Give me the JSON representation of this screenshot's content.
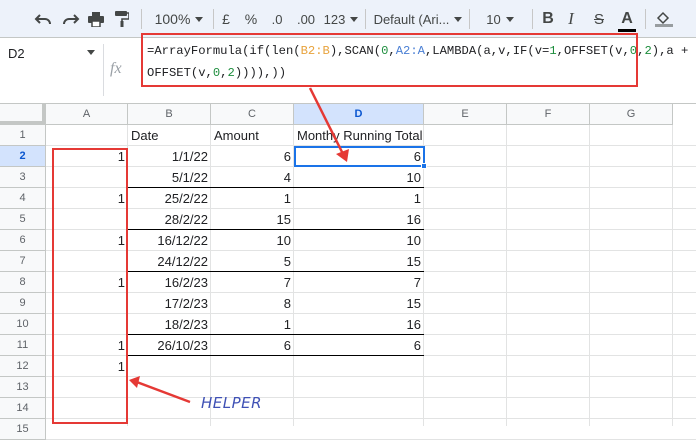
{
  "toolbar": {
    "zoom": "100%",
    "currency": "£",
    "percent": "%",
    "decrease_decimal": ".0",
    "increase_decimal": ".00",
    "more_formats": "123",
    "font": "Default (Ari...",
    "font_size": "10",
    "bold": "B",
    "italic": "I",
    "strike": "S",
    "text_color": "A"
  },
  "formula_bar": {
    "name_box": "D2",
    "fx": "fx",
    "line1": {
      "p1": "=ArrayFormula(if(len(",
      "ref1": "B2:B",
      "p2": "),SCAN(",
      "n1": "0",
      "p3": ",",
      "ref2": "A2:A",
      "p4": ",LAMBDA(a,v,IF(v=",
      "n2": "1",
      "p5": ",OFFSET(v,",
      "n3": "0",
      "p6": ",",
      "n4": "2",
      "p7": "),a +"
    },
    "line2": {
      "p1": "OFFSET(v,",
      "n1": "0",
      "p2": ",",
      "n2": "2",
      "p3": ")))),))"
    }
  },
  "columns": [
    "A",
    "B",
    "C",
    "D",
    "E",
    "F",
    "G"
  ],
  "rows": [
    "1",
    "2",
    "3",
    "4",
    "5",
    "6",
    "7",
    "8",
    "9",
    "10",
    "11",
    "12",
    "13",
    "14",
    "15"
  ],
  "header_row": {
    "date": "Date",
    "amount": "Amount",
    "total": "Monthy Running Total"
  },
  "data_rows": [
    {
      "a": "1",
      "b": "1/1/22",
      "c": "6",
      "d": "6"
    },
    {
      "a": "",
      "b": "5/1/22",
      "c": "4",
      "d": "10"
    },
    {
      "a": "1",
      "b": "25/2/22",
      "c": "1",
      "d": "1"
    },
    {
      "a": "",
      "b": "28/2/22",
      "c": "15",
      "d": "16"
    },
    {
      "a": "1",
      "b": "16/12/22",
      "c": "10",
      "d": "10"
    },
    {
      "a": "",
      "b": "24/12/22",
      "c": "5",
      "d": "15"
    },
    {
      "a": "1",
      "b": "16/2/23",
      "c": "7",
      "d": "7"
    },
    {
      "a": "",
      "b": "17/2/23",
      "c": "8",
      "d": "15"
    },
    {
      "a": "",
      "b": "18/2/23",
      "c": "1",
      "d": "16"
    },
    {
      "a": "1",
      "b": "26/10/23",
      "c": "6",
      "d": "6"
    },
    {
      "a": "1",
      "b": "",
      "c": "",
      "d": ""
    }
  ],
  "annotation": {
    "helper": "HELPER"
  },
  "colors": {
    "highlight": "#e53935",
    "selection": "#1a73e8",
    "annotation_text": "#3f51b5"
  }
}
